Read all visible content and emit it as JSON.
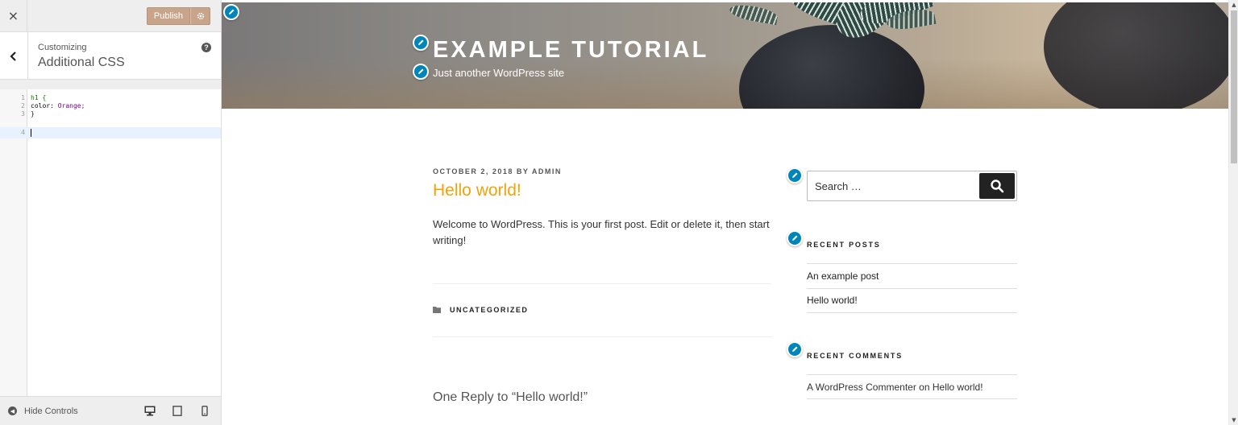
{
  "customizer": {
    "close_label": "×",
    "publish_label": "Publish",
    "settings_icon": "gear-icon",
    "back_icon": "chevron-left-icon",
    "section_small": "Customizing",
    "section_title": "Additional CSS",
    "help_label": "?",
    "code_lines": [
      {
        "num": "1",
        "text": "h1 {"
      },
      {
        "num": "2",
        "text": "color: Orange;"
      },
      {
        "num": "3",
        "text": "}"
      },
      {
        "num": "4",
        "text": ""
      }
    ],
    "hide_controls_label": "Hide Controls",
    "devices": [
      "desktop-icon",
      "tablet-icon",
      "mobile-icon"
    ],
    "colors": {
      "publish": "#c8a48b",
      "accent": "#0085ba"
    }
  },
  "site": {
    "title": "EXAMPLE TUTORIAL",
    "description": "Just another WordPress site"
  },
  "post": {
    "meta_date": "OCTOBER 2, 2018",
    "meta_by": "BY",
    "meta_author": "ADMIN",
    "title": "Hello world!",
    "content": "Welcome to WordPress. This is your first post. Edit or delete it, then start writing!",
    "category": "UNCATEGORIZED",
    "reply_title": "One Reply to “Hello world!”",
    "title_color": "#f0a30a"
  },
  "sidebar_widgets": {
    "search_placeholder": "Search …",
    "recent_posts_title": "RECENT POSTS",
    "recent_posts": [
      "An example post",
      "Hello world!"
    ],
    "recent_comments_title": "RECENT COMMENTS",
    "comment_author": "A WordPress Commenter",
    "comment_on": "on",
    "comment_post": "Hello world!"
  }
}
